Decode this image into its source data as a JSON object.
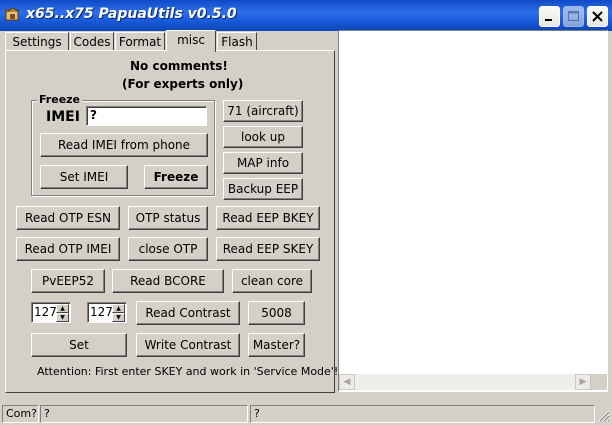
{
  "window": {
    "title": "x65..x75 PapuaUtils v0.5.0",
    "icon": "papua-app-icon"
  },
  "tabs": [
    {
      "label": "Settings",
      "active": false
    },
    {
      "label": "Codes",
      "active": false
    },
    {
      "label": "Format",
      "active": false
    },
    {
      "label": "misc",
      "active": true
    },
    {
      "label": "Flash",
      "active": false
    }
  ],
  "misc": {
    "heading_line1": "No comments!",
    "heading_line2": "(For experts only)",
    "freeze_group_title": "Freeze",
    "imei_label": "IMEI",
    "imei_value": "?",
    "read_imei_button": "Read IMEI from phone",
    "set_imei_button": "Set IMEI",
    "freeze_button": "Freeze",
    "aircraft_button": "71 (aircraft)",
    "lookup_button": "look up",
    "map_info_button": "MAP info",
    "backup_eep_button": "Backup EEP",
    "read_otp_esn_button": "Read OTP ESN",
    "otp_status_button": "OTP status",
    "read_eep_bkey_button": "Read EEP BKEY",
    "read_otp_imei_button": "Read OTP IMEI",
    "close_otp_button": "close OTP",
    "read_eep_skey_button": "Read EEP SKEY",
    "pveep52_button": "PvEEP52",
    "read_bcore_button": "Read BCORE",
    "clean_core_button": "clean core",
    "contrast_spin1": "127",
    "contrast_spin2": "127",
    "read_contrast_button": "Read Contrast",
    "value_5008": "5008",
    "set_button": "Set",
    "write_contrast_button": "Write Contrast",
    "master_button": "Master?",
    "attention_text": "Attention: First enter SKEY and work in 'Service Mode'!"
  },
  "statusbar": {
    "com": "Com?",
    "cell2": "?",
    "cell3": "?"
  }
}
